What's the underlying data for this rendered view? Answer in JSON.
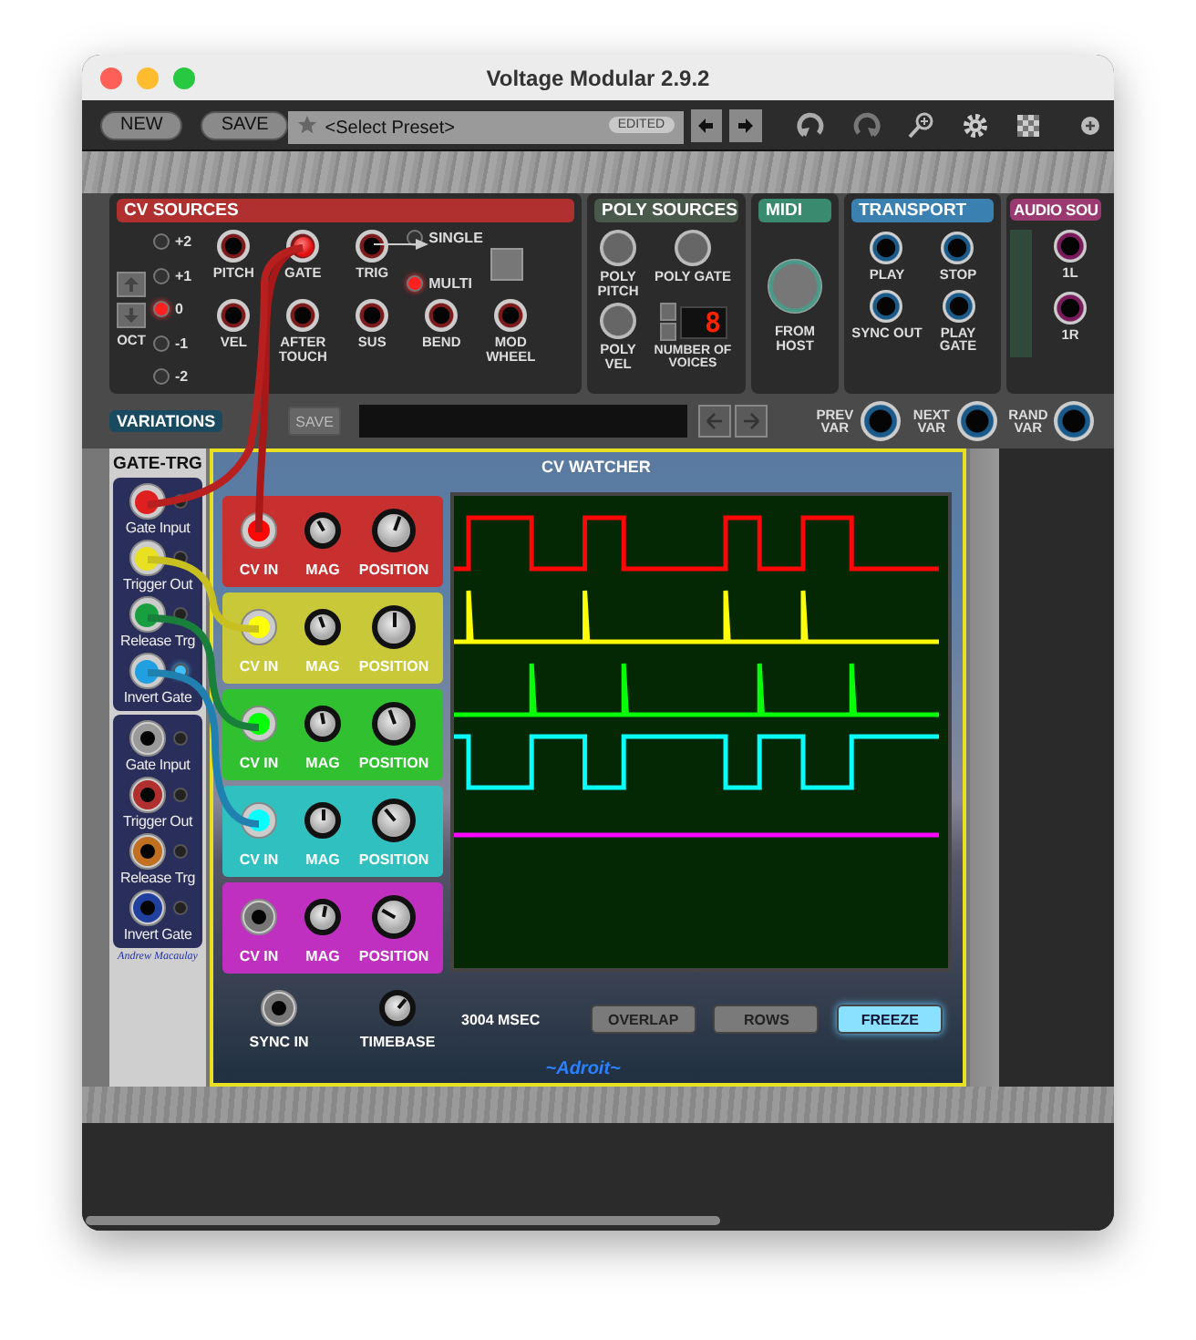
{
  "window": {
    "title": "Voltage Modular 2.9.2"
  },
  "toolbar": {
    "buttons": [
      "NEW",
      "SAVE"
    ],
    "preset": {
      "placeholder": "<Select Preset>",
      "badge": "EDITED"
    }
  },
  "cv_sources": {
    "title": "CV SOURCES",
    "octave_label": "OCT",
    "octave_leds": [
      {
        "label": "+2",
        "on": false
      },
      {
        "label": "+1",
        "on": false
      },
      {
        "label": "0",
        "on": true
      },
      {
        "label": "-1",
        "on": false
      },
      {
        "label": "-2",
        "on": false
      }
    ],
    "jacks": [
      {
        "label": "PITCH",
        "plugged": false
      },
      {
        "label": "GATE",
        "plugged": true
      },
      {
        "label": "TRIG",
        "plugged": false
      },
      {
        "label": "VEL",
        "plugged": false
      },
      {
        "label": "AFTER TOUCH",
        "plugged": false
      },
      {
        "label": "SUS",
        "plugged": false
      },
      {
        "label": "BEND",
        "plugged": false
      },
      {
        "label": "MOD WHEEL",
        "plugged": false
      }
    ],
    "mode": [
      {
        "label": "SINGLE",
        "on": false
      },
      {
        "label": "MULTI",
        "on": true
      }
    ]
  },
  "poly_sources": {
    "title": "POLY SOURCES",
    "jacks": [
      {
        "label": "POLY PITCH"
      },
      {
        "label": "POLY GATE"
      },
      {
        "label": "POLY VEL"
      }
    ],
    "voices_label": "NUMBER OF VOICES",
    "voices_display": "8"
  },
  "midi": {
    "title": "MIDI",
    "jack_label": "FROM HOST"
  },
  "transport": {
    "title": "TRANSPORT",
    "jacks": [
      {
        "label": "PLAY"
      },
      {
        "label": "STOP"
      },
      {
        "label": "SYNC OUT"
      },
      {
        "label": "PLAY GATE"
      }
    ]
  },
  "audio_sources": {
    "title": "AUDIO SOU",
    "jacks": [
      {
        "label": "1L"
      },
      {
        "label": "1R"
      }
    ]
  },
  "variations": {
    "title": "VARIATIONS",
    "save": "SAVE",
    "jacks": [
      {
        "label": "PREV VAR"
      },
      {
        "label": "NEXT VAR"
      },
      {
        "label": "RAND VAR"
      }
    ]
  },
  "gate_trg": {
    "title": "GATE-TRG",
    "groups": [
      [
        {
          "label": "Gate Input",
          "plugged": true,
          "color": "#e02020",
          "led": false
        },
        {
          "label": "Trigger Out",
          "plugged": true,
          "color": "#e8e020",
          "led": false
        },
        {
          "label": "Release Trg",
          "plugged": true,
          "color": "#18a040",
          "led": false
        },
        {
          "label": "Invert Gate",
          "plugged": true,
          "color": "#20a0e0",
          "led": true
        }
      ],
      [
        {
          "label": "Gate Input",
          "plugged": false,
          "color": "#9a9a9a",
          "led": false
        },
        {
          "label": "Trigger Out",
          "plugged": false,
          "color": "#b03030",
          "led": false
        },
        {
          "label": "Release Trg",
          "plugged": false,
          "color": "#c07020",
          "led": false
        },
        {
          "label": "Invert Gate",
          "plugged": false,
          "color": "#2040a0",
          "led": false
        }
      ]
    ],
    "signature": "Andrew Macaulay"
  },
  "cv_watcher": {
    "title": "CV WATCHER",
    "channels": [
      {
        "color": "#c83030",
        "plugged": true,
        "kind": "gate",
        "labels": [
          "CV IN",
          "MAG",
          "POSITION"
        ]
      },
      {
        "color": "#c8c838",
        "plugged": true,
        "kind": "rise-pulse",
        "labels": [
          "CV IN",
          "MAG",
          "POSITION"
        ]
      },
      {
        "color": "#30c030",
        "plugged": true,
        "kind": "fall-pulse",
        "labels": [
          "CV IN",
          "MAG",
          "POSITION"
        ]
      },
      {
        "color": "#30c0c0",
        "plugged": true,
        "kind": "inverted-gate",
        "labels": [
          "CV IN",
          "MAG",
          "POSITION"
        ]
      },
      {
        "color": "#c030c0",
        "plugged": false,
        "kind": "flat",
        "labels": [
          "CV IN",
          "MAG",
          "POSITION"
        ]
      }
    ],
    "sync_label": "SYNC IN",
    "timebase_label": "TIMEBASE",
    "reading": "3004 MSEC",
    "buttons": [
      {
        "label": "OVERLAP",
        "selected": false
      },
      {
        "label": "ROWS",
        "selected": false
      },
      {
        "label": "FREEZE",
        "selected": true
      }
    ],
    "brand": "~Adroit~"
  }
}
